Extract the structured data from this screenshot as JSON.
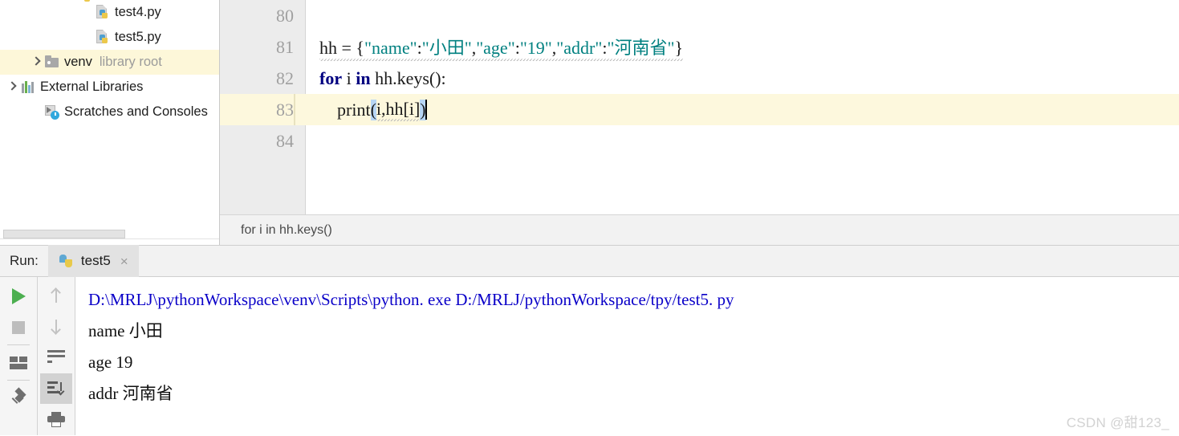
{
  "project_tree": {
    "items": [
      {
        "label": "test4.py",
        "sub": "",
        "icon": "python-file-icon",
        "arrow": "none",
        "indent": 101,
        "highlight": false
      },
      {
        "label": "test5.py",
        "sub": "",
        "icon": "python-file-icon",
        "arrow": "none",
        "indent": 101,
        "highlight": false
      },
      {
        "label": "venv",
        "sub": "library root",
        "icon": "folder-icon",
        "arrow": "closed",
        "indent": 38,
        "highlight": true
      },
      {
        "label": "External Libraries",
        "sub": "",
        "icon": "libraries-bars-icon",
        "arrow": "closed",
        "indent": 8,
        "highlight": false
      },
      {
        "label": "Scratches and Consoles",
        "sub": "",
        "icon": "scratches-clock-icon",
        "arrow": "none",
        "indent": 38,
        "highlight": false
      }
    ]
  },
  "editor": {
    "line_numbers": [
      "80",
      "81",
      "82",
      "83",
      "84"
    ],
    "current_line": "83",
    "lines": [
      {
        "num": "80",
        "tokens": []
      },
      {
        "num": "81",
        "tokens": [
          {
            "t": "hh = ",
            "c": "plain"
          },
          {
            "t": "{",
            "c": "plain"
          },
          {
            "t": "\"name\"",
            "c": "str"
          },
          {
            "t": ":",
            "c": "plain"
          },
          {
            "t": "\"小田\"",
            "c": "str"
          },
          {
            "t": ",",
            "c": "plain"
          },
          {
            "t": "\"age\"",
            "c": "str"
          },
          {
            "t": ":",
            "c": "plain"
          },
          {
            "t": "\"19\"",
            "c": "str"
          },
          {
            "t": ",",
            "c": "plain"
          },
          {
            "t": "\"addr\"",
            "c": "str"
          },
          {
            "t": ":",
            "c": "plain"
          },
          {
            "t": "\"河南省\"",
            "c": "str"
          },
          {
            "t": "}",
            "c": "plain"
          }
        ]
      },
      {
        "num": "82",
        "tokens": [
          {
            "t": "for",
            "c": "kw"
          },
          {
            "t": " i ",
            "c": "plain"
          },
          {
            "t": "in",
            "c": "kw"
          },
          {
            "t": " hh.keys():",
            "c": "plain"
          }
        ]
      },
      {
        "num": "83",
        "tokens": [
          {
            "t": "    print",
            "c": "plain"
          },
          {
            "t": "(",
            "c": "brace"
          },
          {
            "t": "i,hh[i]",
            "c": "plain"
          },
          {
            "t": ")",
            "c": "brace"
          }
        ]
      },
      {
        "num": "84",
        "tokens": []
      }
    ],
    "code_text_line81": "hh = {\"name\":\"小田\",\"age\":\"19\",\"addr\":\"河南省\"}",
    "code_text_line82": "for i in hh.keys():",
    "code_text_line83": "    print(i,hh[i])",
    "breadcrumb": "for i in hh.keys()"
  },
  "run_panel": {
    "label": "Run:",
    "tab_title": "test5",
    "close_label": "×",
    "toolbar_primary": [
      {
        "name": "run-button",
        "icon": "play-icon"
      },
      {
        "name": "stop-button",
        "icon": "stop-icon"
      },
      {
        "name": "layout-button",
        "icon": "layout-icon"
      },
      {
        "name": "pin-tab-button",
        "icon": "pin-icon"
      }
    ],
    "toolbar_secondary": [
      {
        "name": "up-button",
        "icon": "arrow-up-icon"
      },
      {
        "name": "down-button",
        "icon": "arrow-down-icon"
      },
      {
        "name": "soft-wrap-button",
        "icon": "soft-wrap-icon"
      },
      {
        "name": "scroll-to-end-button",
        "icon": "scroll-to-end-icon"
      },
      {
        "name": "print-button",
        "icon": "print-icon"
      }
    ],
    "console_lines": [
      {
        "text": "D:\\MRLJ\\pythonWorkspace\\venv\\Scripts\\python. exe D:/MRLJ/pythonWorkspace/tpy/test5. py",
        "kind": "cmd"
      },
      {
        "text": "name 小田",
        "kind": "out"
      },
      {
        "text": "age 19",
        "kind": "out"
      },
      {
        "text": "addr 河南省",
        "kind": "out"
      }
    ]
  },
  "watermark": {
    "text": "CSDN @甜123_"
  },
  "colors": {
    "keyword": "#000080",
    "string": "#008080",
    "console_command": "#0a00c8",
    "current_line_bg": "#fdf8dd",
    "tree_highlight_bg": "#fdf7d9",
    "brace_highlight": "#b7d6f5",
    "run_icon_green": "#4caf50"
  }
}
